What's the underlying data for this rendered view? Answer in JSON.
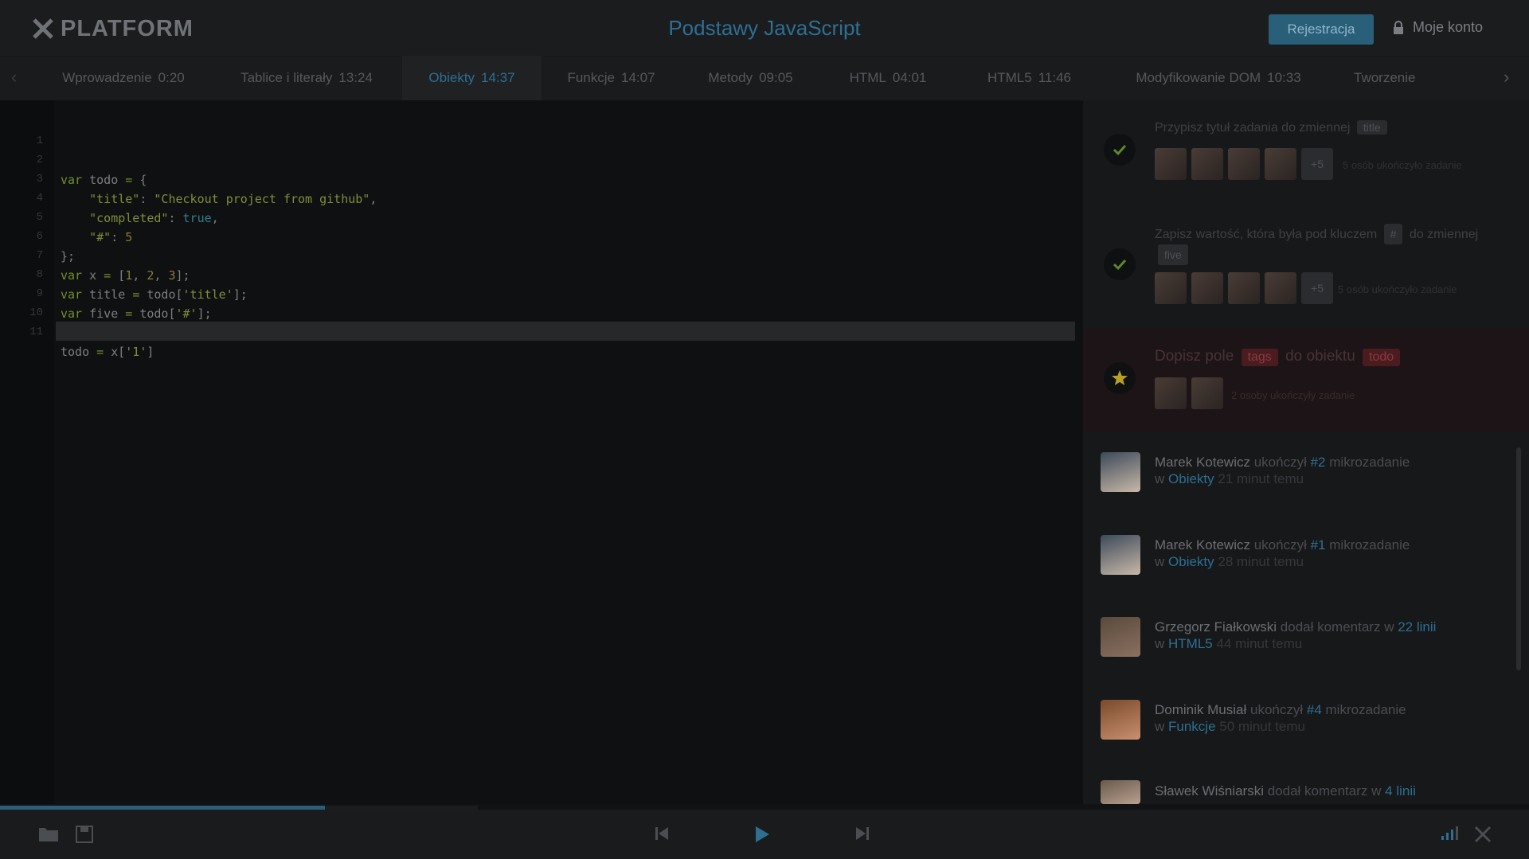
{
  "header": {
    "logo_text": "PLATFORM",
    "course_title": "Podstawy JavaScript",
    "register_label": "Rejestracja",
    "account_label": "Moje konto"
  },
  "tabs": [
    {
      "label": "Wprowadzenie",
      "time": "0:20"
    },
    {
      "label": "Tablice i literały",
      "time": "13:24"
    },
    {
      "label": "Obiekty",
      "time": "14:37",
      "active": true
    },
    {
      "label": "Funkcje",
      "time": "14:07"
    },
    {
      "label": "Metody",
      "time": "09:05"
    },
    {
      "label": "HTML",
      "time": "04:01"
    },
    {
      "label": "HTML5",
      "time": "11:46"
    },
    {
      "label": "Modyfikowanie DOM",
      "time": "10:33"
    },
    {
      "label": "Tworzenie",
      "time": ""
    }
  ],
  "editor": {
    "line_numbers": [
      "1",
      "2",
      "3",
      "4",
      "5",
      "6",
      "7",
      "8",
      "9",
      "10",
      "11"
    ],
    "current_line": "11"
  },
  "tasks": [
    {
      "title": "Przypisz tytuł zadania do zmiennej",
      "chip": "title",
      "status": "done",
      "completed_text": "5 osób ukończyło zadanie",
      "more": "+5"
    },
    {
      "title_1": "Zapisz wartość, która była pod kluczem",
      "chip_1": "#",
      "title_2": "do",
      "title_3": "zmiennej",
      "chip_2": "five",
      "status": "done",
      "completed_text": "5 osób ukończyło zadanie",
      "more": "+5"
    },
    {
      "title_1": "Dopisz pole",
      "chip_1": "tags",
      "title_2": "do obiektu",
      "chip_2": "todo",
      "status": "active",
      "completed_text": "2 osoby ukończyły zadanie"
    }
  ],
  "feed": [
    {
      "name": "Marek Kotewicz",
      "action": "ukończył",
      "target": "#2",
      "rest": "mikrozadanie",
      "in": "w",
      "lesson": "Obiekty",
      "time": "21 minut temu"
    },
    {
      "name": "Marek Kotewicz",
      "action": "ukończył",
      "target": "#1",
      "rest": "mikrozadanie",
      "in": "w",
      "lesson": "Obiekty",
      "time": "28 minut temu"
    },
    {
      "name": "Grzegorz Fiałkowski",
      "action": "dodał komentarz",
      "target": "22 linii",
      "rest": "",
      "in": "w",
      "lesson": "HTML5",
      "time": "44 minut temu"
    },
    {
      "name": "Dominik Musiał",
      "action": "ukończył",
      "target": "#4",
      "rest": "mikrozadanie",
      "in": "w",
      "lesson": "Funkcje",
      "time": "50 minut temu"
    },
    {
      "name": "Sławek Wiśniarski",
      "action": "dodał komentarz",
      "target": "4 linii",
      "rest": "",
      "in": "w",
      "lesson": "",
      "time": ""
    }
  ],
  "player": {
    "progress": 0.68
  },
  "colors": {
    "accent": "#2d6f93",
    "active_task_bg": "#1c1416",
    "done": "#5a8a2a",
    "star": "#b8a020"
  }
}
